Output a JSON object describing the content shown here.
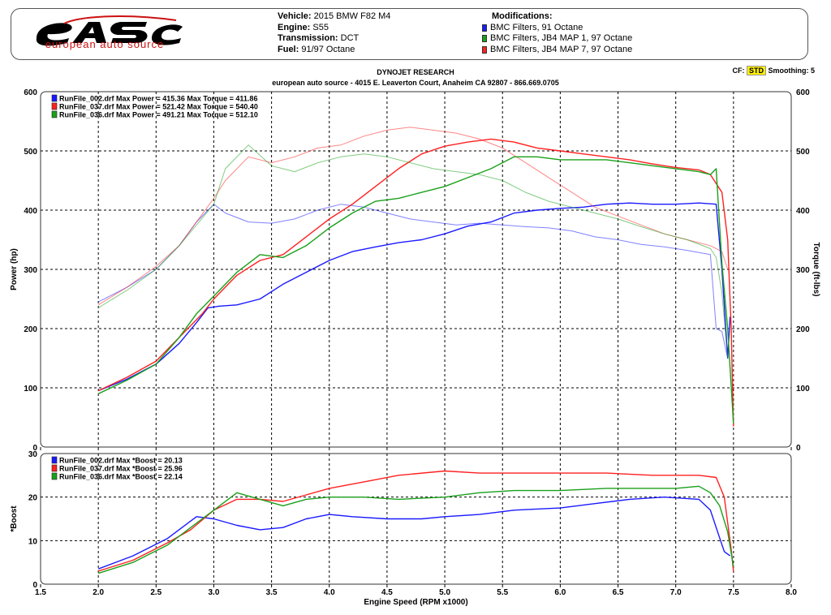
{
  "logo": {
    "text": "european auto source"
  },
  "vehicle": [
    {
      "label": "Vehicle:",
      "value": "2015 BMW F82 M4"
    },
    {
      "label": "Engine:",
      "value": "S55"
    },
    {
      "label": "Transmission:",
      "value": "DCT"
    },
    {
      "label": "Fuel:",
      "value": "91/97 Octane"
    }
  ],
  "modifications": {
    "title": "Modifications:",
    "items": [
      {
        "label": "BMC Filters, 91 Octane",
        "color": "#1a1aff"
      },
      {
        "label": "BMC Filters, JB4 MAP 1, 97 Octane",
        "color": "#1aa01a"
      },
      {
        "label": "BMC Filters, JB4 MAP 7, 97 Octane",
        "color": "#ff2020"
      }
    ]
  },
  "dyno": {
    "title": "DYNOJET RESEARCH",
    "address": "european auto source - 4015 E. Leaverton Court, Anaheim CA 92807 - 866.669.0705"
  },
  "cf": {
    "label": "CF:",
    "value": "STD",
    "smoothing": "Smoothing: 5"
  },
  "chart_data": [
    {
      "type": "line",
      "ylabel": "Power (hp)",
      "y2label": "Torque (ft-lbs)",
      "xlim": [
        1.5,
        8.0
      ],
      "ylim": [
        0,
        600
      ],
      "xticks": [
        "1.5",
        "2.0",
        "2.5",
        "3.0",
        "3.5",
        "4.0",
        "4.5",
        "5.0",
        "5.5",
        "6.0",
        "6.5",
        "7.0",
        "7.5",
        "8.0"
      ],
      "yticks": [
        "0",
        "100",
        "200",
        "300",
        "400",
        "500",
        "600"
      ],
      "grid": true,
      "legend_position": "top-left",
      "legend": [
        {
          "text": "RunFile_002.drf Max Power = 415.36     Max Torque = 411.86",
          "color": "#1a1aff"
        },
        {
          "text": "RunFile_037.drf Max Power = 521.42     Max Torque = 540.40",
          "color": "#ff2020"
        },
        {
          "text": "RunFile_036.drf Max Power = 491.21     Max Torque = 512.10",
          "color": "#1aa01a"
        }
      ],
      "series": [
        {
          "run": "002",
          "kind": "power",
          "color": "#1a1aff",
          "x": [
            2.0,
            2.25,
            2.5,
            2.7,
            2.85,
            2.95,
            3.05,
            3.2,
            3.4,
            3.6,
            3.8,
            4.0,
            4.2,
            4.4,
            4.6,
            4.8,
            5.0,
            5.2,
            5.4,
            5.6,
            5.8,
            6.0,
            6.2,
            6.4,
            6.6,
            6.8,
            7.0,
            7.2,
            7.35,
            7.4,
            7.45,
            7.47
          ],
          "y": [
            95,
            115,
            140,
            175,
            210,
            235,
            238,
            240,
            250,
            275,
            295,
            315,
            330,
            338,
            345,
            350,
            360,
            373,
            380,
            395,
            400,
            403,
            405,
            410,
            412,
            410,
            410,
            412,
            410,
            300,
            150,
            220
          ]
        },
        {
          "run": "002",
          "kind": "torque",
          "color": "#1a1aff",
          "x": [
            2.0,
            2.25,
            2.5,
            2.7,
            2.85,
            3.0,
            3.1,
            3.3,
            3.5,
            3.7,
            3.9,
            4.1,
            4.3,
            4.5,
            4.7,
            4.9,
            5.1,
            5.3,
            5.5,
            5.7,
            5.9,
            6.1,
            6.3,
            6.5,
            6.7,
            6.9,
            7.1,
            7.3,
            7.35,
            7.4,
            7.45
          ],
          "y": [
            245,
            270,
            300,
            340,
            380,
            410,
            395,
            380,
            378,
            385,
            400,
            410,
            405,
            395,
            385,
            380,
            375,
            378,
            375,
            372,
            370,
            365,
            355,
            350,
            342,
            338,
            332,
            325,
            200,
            195,
            150
          ]
        },
        {
          "run": "037",
          "kind": "power",
          "color": "#ff2020",
          "x": [
            2.0,
            2.25,
            2.5,
            2.7,
            2.9,
            3.0,
            3.2,
            3.4,
            3.6,
            3.8,
            4.0,
            4.2,
            4.4,
            4.6,
            4.8,
            5.0,
            5.2,
            5.4,
            5.6,
            5.8,
            6.0,
            6.2,
            6.4,
            6.6,
            6.8,
            7.0,
            7.2,
            7.3,
            7.4,
            7.45,
            7.48,
            7.5
          ],
          "y": [
            95,
            118,
            145,
            185,
            225,
            250,
            290,
            315,
            325,
            355,
            385,
            410,
            440,
            470,
            495,
            508,
            515,
            520,
            515,
            505,
            500,
            495,
            490,
            485,
            478,
            472,
            468,
            460,
            430,
            350,
            200,
            35
          ]
        },
        {
          "run": "037",
          "kind": "torque",
          "color": "#ff2020",
          "x": [
            2.0,
            2.25,
            2.5,
            2.7,
            2.85,
            3.0,
            3.1,
            3.3,
            3.5,
            3.7,
            3.9,
            4.1,
            4.3,
            4.5,
            4.7,
            4.9,
            5.1,
            5.3,
            5.5,
            5.7,
            5.9,
            6.1,
            6.3,
            6.5,
            6.7,
            6.9,
            7.1,
            7.3,
            7.4,
            7.45
          ],
          "y": [
            240,
            270,
            305,
            340,
            380,
            420,
            450,
            490,
            480,
            490,
            505,
            510,
            525,
            535,
            540,
            535,
            530,
            520,
            505,
            480,
            455,
            430,
            405,
            390,
            375,
            360,
            350,
            340,
            330,
            300
          ]
        },
        {
          "run": "036",
          "kind": "power",
          "color": "#1aa01a",
          "x": [
            2.0,
            2.25,
            2.5,
            2.7,
            2.85,
            3.0,
            3.2,
            3.4,
            3.6,
            3.8,
            4.0,
            4.2,
            4.4,
            4.6,
            4.8,
            5.0,
            5.2,
            5.4,
            5.6,
            5.8,
            6.0,
            6.2,
            6.4,
            6.6,
            6.8,
            7.0,
            7.2,
            7.3,
            7.35,
            7.4,
            7.45,
            7.5
          ],
          "y": [
            90,
            113,
            140,
            185,
            225,
            255,
            295,
            325,
            320,
            340,
            370,
            395,
            415,
            420,
            430,
            440,
            455,
            470,
            490,
            490,
            485,
            485,
            485,
            480,
            475,
            470,
            465,
            460,
            470,
            310,
            200,
            40
          ]
        },
        {
          "run": "036",
          "kind": "torque",
          "color": "#1aa01a",
          "x": [
            2.0,
            2.25,
            2.5,
            2.7,
            2.85,
            3.0,
            3.1,
            3.3,
            3.5,
            3.7,
            3.9,
            4.1,
            4.3,
            4.5,
            4.7,
            4.9,
            5.1,
            5.3,
            5.5,
            5.7,
            5.9,
            6.1,
            6.3,
            6.5,
            6.7,
            6.9,
            7.1,
            7.3,
            7.35,
            7.4,
            7.45
          ],
          "y": [
            235,
            265,
            300,
            340,
            375,
            410,
            470,
            510,
            475,
            465,
            480,
            490,
            495,
            490,
            480,
            470,
            465,
            460,
            450,
            430,
            415,
            405,
            395,
            385,
            372,
            360,
            350,
            335,
            320,
            260,
            150
          ]
        }
      ]
    },
    {
      "type": "line",
      "ylabel": "*Boost",
      "xlabel": "Engine Speed (RPM x1000)",
      "xlim": [
        1.5,
        8.0
      ],
      "ylim": [
        0,
        30
      ],
      "xticks": [
        "1.5",
        "2.0",
        "2.5",
        "3.0",
        "3.5",
        "4.0",
        "4.5",
        "5.0",
        "5.5",
        "6.0",
        "6.5",
        "7.0",
        "7.5",
        "8.0"
      ],
      "yticks": [
        "0",
        "10",
        "20",
        "30"
      ],
      "grid": true,
      "legend_position": "top-left",
      "legend": [
        {
          "text": "RunFile_002.drf Max *Boost = 20.13",
          "color": "#1a1aff"
        },
        {
          "text": "RunFile_037.drf Max *Boost = 25.96",
          "color": "#ff2020"
        },
        {
          "text": "RunFile_036.drf Max *Boost = 22.14",
          "color": "#1aa01a"
        }
      ],
      "series": [
        {
          "run": "002",
          "color": "#1a1aff",
          "x": [
            2.0,
            2.3,
            2.6,
            2.85,
            3.0,
            3.2,
            3.4,
            3.6,
            3.8,
            4.0,
            4.2,
            4.5,
            4.8,
            5.0,
            5.3,
            5.6,
            6.0,
            6.3,
            6.6,
            6.9,
            7.2,
            7.3,
            7.35,
            7.42,
            7.47
          ],
          "y": [
            3.5,
            6.5,
            10.5,
            15.5,
            15,
            13.5,
            12.5,
            13,
            15,
            16,
            15.5,
            15,
            15,
            15.5,
            16,
            17,
            17.5,
            18.5,
            19.5,
            20,
            19.5,
            17,
            13,
            7.5,
            6.5
          ]
        },
        {
          "run": "037",
          "color": "#ff2020",
          "x": [
            2.0,
            2.3,
            2.6,
            2.8,
            3.0,
            3.2,
            3.4,
            3.6,
            3.8,
            4.0,
            4.3,
            4.6,
            5.0,
            5.3,
            5.6,
            6.0,
            6.4,
            6.8,
            7.0,
            7.2,
            7.35,
            7.42,
            7.48,
            7.5
          ],
          "y": [
            3,
            5.5,
            9.5,
            12.5,
            17,
            19.5,
            19.5,
            19,
            20.5,
            22,
            23.5,
            25,
            26,
            25.5,
            25.5,
            25.5,
            25.5,
            25,
            25,
            25,
            24.5,
            20,
            8,
            3
          ]
        },
        {
          "run": "036",
          "color": "#1aa01a",
          "x": [
            2.0,
            2.3,
            2.6,
            2.8,
            3.0,
            3.2,
            3.4,
            3.6,
            3.8,
            4.0,
            4.3,
            4.6,
            5.0,
            5.3,
            5.6,
            6.0,
            6.4,
            6.8,
            7.0,
            7.2,
            7.3,
            7.38,
            7.45,
            7.5
          ],
          "y": [
            2.5,
            5,
            9,
            13,
            17,
            21,
            19.5,
            18,
            19.5,
            20,
            20,
            19.5,
            20,
            21,
            21.5,
            21.5,
            22,
            22,
            22,
            22.5,
            21,
            18,
            12,
            4
          ]
        }
      ]
    }
  ]
}
